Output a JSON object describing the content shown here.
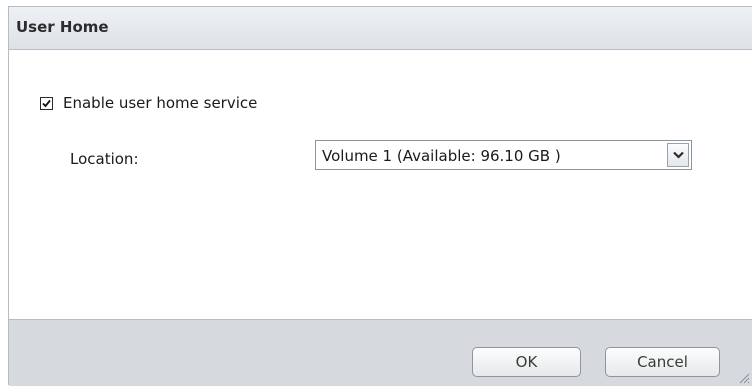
{
  "dialog": {
    "title": "User Home",
    "enable_checkbox": {
      "label": "Enable user home service",
      "checked": true
    },
    "location": {
      "label": "Location:",
      "selected_value": "Volume 1 (Available: 96.10 GB )"
    },
    "buttons": {
      "ok": "OK",
      "cancel": "Cancel"
    }
  },
  "icons": {
    "checkbox": "checkmark-icon",
    "dropdown": "chevron-down-icon",
    "resize": "resize-grip-icon"
  }
}
